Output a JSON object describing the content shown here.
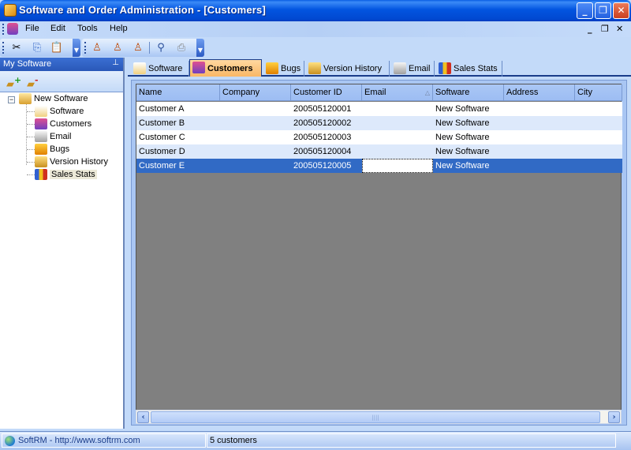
{
  "window": {
    "title": "Software and Order Administration - [Customers]"
  },
  "menu": {
    "items": [
      "File",
      "Edit",
      "Tools",
      "Help"
    ]
  },
  "toolbar1": {
    "buttons": [
      "cut-icon",
      "copy-icon",
      "paste-icon"
    ]
  },
  "toolbar2": {
    "buttons": [
      "add-customer-icon",
      "remove-customer-icon",
      "edit-customer-icon",
      "find-icon",
      "print-icon"
    ]
  },
  "sidebar": {
    "title": "My Software",
    "tools": [
      "add-software-icon",
      "remove-software-icon"
    ],
    "root": "New Software",
    "items": [
      "Software",
      "Customers",
      "Email",
      "Bugs",
      "Version History",
      "Sales Stats"
    ],
    "selected": "Sales Stats"
  },
  "tabs": [
    {
      "label": "Software",
      "icon": "software-icon"
    },
    {
      "label": "Customers",
      "icon": "customers-icon",
      "active": true
    },
    {
      "label": "Bugs",
      "icon": "bugs-icon"
    },
    {
      "label": "Version History",
      "icon": "version-history-icon"
    },
    {
      "label": "Email",
      "icon": "email-icon"
    },
    {
      "label": "Sales Stats",
      "icon": "sales-stats-icon"
    }
  ],
  "grid": {
    "columns": [
      "Name",
      "Company",
      "Customer ID",
      "Email",
      "Software",
      "Address",
      "City"
    ],
    "sorted_column": "Email",
    "rows": [
      [
        "Customer A",
        "",
        "200505120001",
        "",
        "New Software",
        "",
        ""
      ],
      [
        "Customer B",
        "",
        "200505120002",
        "",
        "New Software",
        "",
        ""
      ],
      [
        "Customer C",
        "",
        "200505120003",
        "",
        "New Software",
        "",
        ""
      ],
      [
        "Customer D",
        "",
        "200505120004",
        "",
        "New Software",
        "",
        ""
      ],
      [
        "Customer E",
        "",
        "200505120005",
        "",
        "New Software",
        "",
        ""
      ]
    ],
    "selected_row": 4
  },
  "status": {
    "link": "SoftRM - http://www.softrm.com",
    "count": "5 customers"
  },
  "colors": {
    "title_bar": "#0255e0",
    "selection": "#316ac5",
    "active_tab": "#f9b765"
  }
}
